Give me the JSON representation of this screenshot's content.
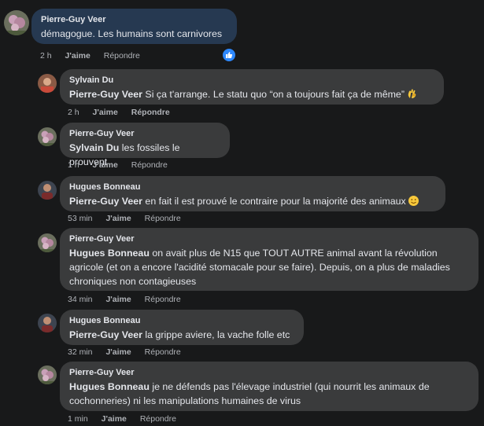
{
  "comments": [
    {
      "author": "Pierre-Guy Veer",
      "mention": "",
      "text": "démagogue. Les humains sont carnivores",
      "time": "2 h",
      "like": "J'aime",
      "reply": "Répondre",
      "reaction": "like-icon"
    },
    {
      "author": "Sylvain Du",
      "mention": "Pierre-Guy Veer",
      "text": " Si ça t'arrange. Le statu quo “on a toujours fait ça de même”",
      "emoji": "ok-hand-emoji",
      "time": "2 h",
      "like": "J'aime",
      "reply": "Répondre"
    },
    {
      "author": "Pierre-Guy Veer",
      "mention": "Sylvain Du",
      "text": " les fossiles le prouvent",
      "time": "1 h",
      "like": "J'aime",
      "reply": "Répondre"
    },
    {
      "author": "Hugues Bonneau",
      "mention": "Pierre-Guy Veer",
      "text": " en fait il est prouvé le contraire pour la majorité des animaux",
      "emoji": "smile-emoji",
      "time": "53 min",
      "like": "J'aime",
      "reply": "Répondre"
    },
    {
      "author": "Pierre-Guy Veer",
      "mention": "Hugues Bonneau",
      "text": " on avait plus de N15 que TOUT AUTRE animal avant la révolution agricole (et on a encore l'acidité stomacale pour se faire). Depuis, on a plus de maladies chroniques non contagieuses",
      "time": "34 min",
      "like": "J'aime",
      "reply": "Répondre"
    },
    {
      "author": "Hugues Bonneau",
      "mention": "Pierre-Guy Veer",
      "text": " la grippe aviere, la vache folle etc",
      "time": "32 min",
      "like": "J'aime",
      "reply": "Répondre"
    },
    {
      "author": "Pierre-Guy Veer",
      "mention": "Hugues Bonneau",
      "text": " je ne défends pas l'élevage industriel (qui nourrit les animaux de cochonneries) ni les manipulations humaines de virus",
      "time": "1 min",
      "like": "J'aime",
      "reply": "Répondre"
    }
  ],
  "colors": {
    "background": "#18191a",
    "bubble": "#3a3b3c",
    "bubble_highlight": "#263951",
    "meta": "#b0b3b8",
    "like_blue": "#2d88ff"
  }
}
